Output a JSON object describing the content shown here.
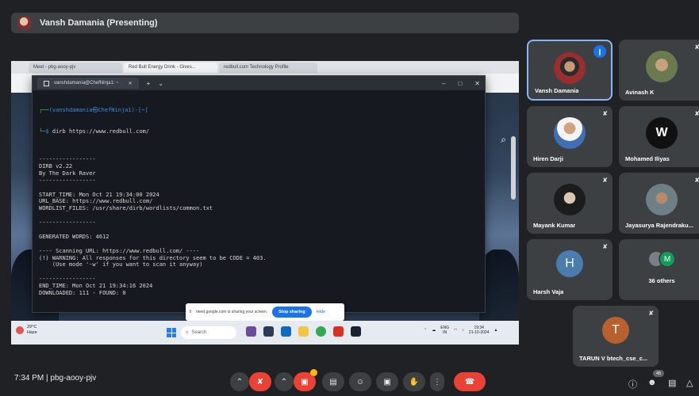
{
  "presenter": {
    "label": "Vansh Damania (Presenting)"
  },
  "browser": {
    "tabs": [
      "Meet - pbg-aooy-pjv",
      "Red Bull Energy Drink - Gives...",
      "redbull.com Technology Profile"
    ]
  },
  "terminal": {
    "tab_title": "vanshdamania@ChefNinja1: ~",
    "prompt_user": "(vanshdamania㉿ChefNinja1)-[~]",
    "command": "dirb https://www.redbull.com/",
    "lines": [
      "",
      "-----------------",
      "DIRB v2.22",
      "By The Dark Raver",
      "-----------------",
      "",
      "START_TIME: Mon Oct 21 19:34:00 2024",
      "URL_BASE: https://www.redbull.com/",
      "WORDLIST_FILES: /usr/share/dirb/wordlists/common.txt",
      "",
      "-----------------",
      "",
      "GENERATED WORDS: 4612",
      "",
      "---- Scanning URL: https://www.redbull.com/ ----",
      "(!) WARNING: All responses for this directory seem to be CODE = 403.",
      "    (Use mode '-w' if you want to scan it anyway)",
      "",
      "-----------------",
      "END_TIME: Mon Oct 21 19:34:16 2024",
      "DOWNLOADED: 111 - FOUND: 0"
    ]
  },
  "share_banner": {
    "message": "meet.google.com is sharing your screen.",
    "stop_label": "Stop sharing",
    "hide_label": "Hide"
  },
  "taskbar": {
    "weather_temp": "29°C",
    "weather_desc": "Haze",
    "search_label": "Search",
    "lang_top": "ENG",
    "lang_bottom": "IN",
    "time": "19:34",
    "date": "21-10-2024"
  },
  "participants": [
    {
      "name": "Vansh Damania",
      "speaking": true
    },
    {
      "name": "Avinash K"
    },
    {
      "name": "Hiren Darji"
    },
    {
      "name": "Mohamed Iliyas"
    },
    {
      "name": "Mayank Kumar"
    },
    {
      "name": "Jayasurya Rajendraku..."
    },
    {
      "name": "Harsh Vaja",
      "initial": "H"
    },
    {
      "name": "36 others",
      "initial": "M"
    },
    {
      "name": "TARUN V btech_cse_c...",
      "initial": "T"
    }
  ],
  "meeting": {
    "time": "7:34 PM",
    "code": "pbg-aooy-pjv",
    "participant_count": "45"
  },
  "colors": {
    "accent": "#1a73e8",
    "end_call": "#ea4335",
    "tile_bg": "#3c4043",
    "harsh_avatar": "#4a7dae",
    "tarun_avatar": "#b8612f",
    "others_m": "#0f9d58"
  }
}
